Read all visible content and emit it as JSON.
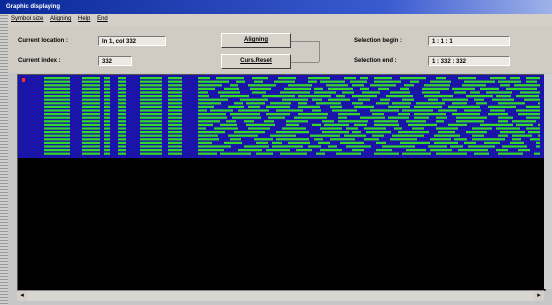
{
  "window": {
    "title": "Graphic displaying"
  },
  "menu": [
    {
      "label": "Symbol size"
    },
    {
      "label": "Aligning"
    },
    {
      "label": "Help"
    },
    {
      "label": "End"
    }
  ],
  "panel": {
    "current_location_label": "Current location :",
    "current_location_value": "ln 1, col 332",
    "current_index_label": "Current index :",
    "current_index_value": "332",
    "aligning_button": "Aligning",
    "curs_reset_button": "Curs.Reset",
    "selection_begin_label": "Selection begin :",
    "selection_begin_value": "1 : 1 : 1",
    "selection_end_label": "Selection end :",
    "selection_end_value": "1 : 332 : 332"
  },
  "colors": {
    "background_band": "#1a14a8",
    "green_bar": "#33d82a",
    "canvas": "#000000",
    "cursor_marker": "#ff2a2a"
  },
  "scroll": {
    "left_arrow": "◂",
    "right_arrow": "▸"
  }
}
